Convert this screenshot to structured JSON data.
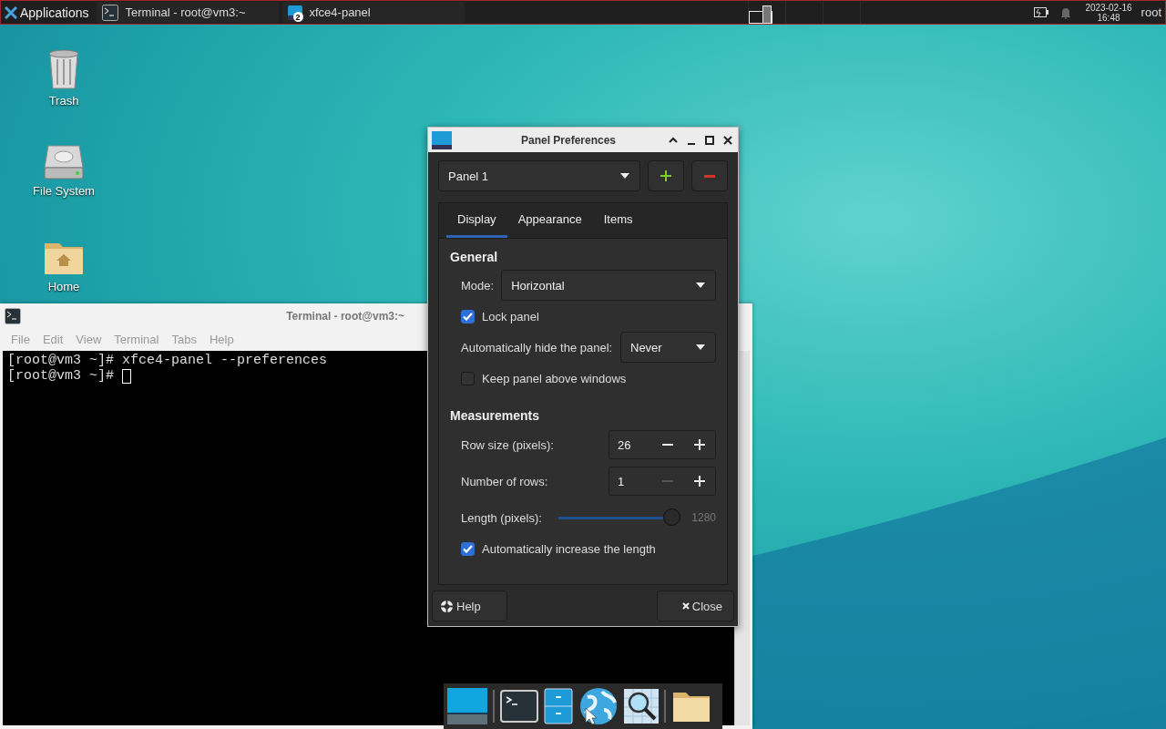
{
  "top_panel": {
    "apps_label": "Applications",
    "tasks": [
      {
        "title": "Terminal - root@vm3:~",
        "kind": "terminal"
      },
      {
        "title": "xfce4-panel",
        "kind": "panel",
        "badge": "2"
      }
    ],
    "clock": {
      "date": "2023-02-16",
      "time": "16:48"
    },
    "user": "root"
  },
  "desktop_icons": [
    {
      "label": "Trash",
      "kind": "trash"
    },
    {
      "label": "File System",
      "kind": "drive"
    },
    {
      "label": "Home",
      "kind": "home"
    }
  ],
  "terminal": {
    "title": "Terminal - root@vm3:~",
    "menu": [
      "File",
      "Edit",
      "View",
      "Terminal",
      "Tabs",
      "Help"
    ],
    "lines": [
      "[root@vm3 ~]# xfce4-panel --preferences",
      "[root@vm3 ~]# "
    ]
  },
  "dialog": {
    "title": "Panel Preferences",
    "panel_select": "Panel 1",
    "tabs": [
      {
        "label": "Display",
        "selected": true
      },
      {
        "label": "Appearance",
        "selected": false
      },
      {
        "label": "Items",
        "selected": false
      }
    ],
    "general_heading": "General",
    "mode_label": "Mode:",
    "mode_value": "Horizontal",
    "lock_panel": {
      "label": "Lock panel",
      "checked": true
    },
    "autohide_label": "Automatically hide the panel:",
    "autohide_value": "Never",
    "keep_above": {
      "label": "Keep panel above windows",
      "checked": false
    },
    "measurements_heading": "Measurements",
    "spinners": [
      {
        "label": "Row size (pixels):",
        "value": "26",
        "minus_disabled": false
      },
      {
        "label": "Number of rows:",
        "value": "1",
        "minus_disabled": true
      }
    ],
    "length": {
      "label": "Length (pixels):",
      "level": 1,
      "reading": "1280"
    },
    "auto_increase": {
      "label": "Automatically increase the length",
      "checked": true
    },
    "help": "Help",
    "close": "Close"
  },
  "dock": [
    {
      "kind": "desktop"
    },
    {
      "kind": "separator"
    },
    {
      "kind": "terminal"
    },
    {
      "kind": "files"
    },
    {
      "kind": "browser"
    },
    {
      "kind": "search"
    },
    {
      "kind": "separator"
    },
    {
      "kind": "folder"
    }
  ]
}
